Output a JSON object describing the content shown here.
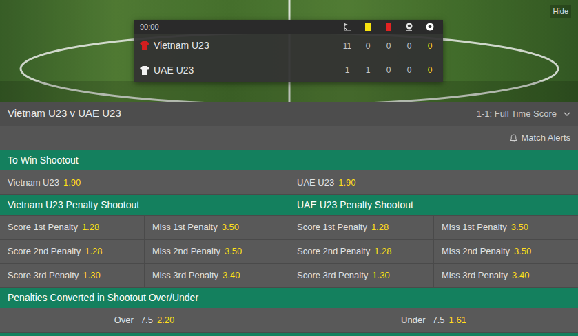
{
  "scoreboard": {
    "time": "90:00",
    "hide": "Hide",
    "teams": [
      {
        "name": "Vietnam U23",
        "color": "#d21f1f",
        "stats": [
          "11",
          "0",
          "0",
          "0",
          "0"
        ]
      },
      {
        "name": "UAE U23",
        "color": "#f2f2f2",
        "stats": [
          "1",
          "1",
          "0",
          "0",
          "0"
        ]
      }
    ]
  },
  "match": {
    "title": "Vietnam U23 v UAE U23",
    "score_label": "1-1: Full Time Score",
    "alerts": "Match Alerts"
  },
  "markets": [
    {
      "kind": "two-way",
      "title": "To Win Shootout",
      "selections": [
        {
          "label": "Vietnam U23",
          "odds": "1.90"
        },
        {
          "label": "UAE U23",
          "odds": "1.90"
        }
      ]
    },
    {
      "kind": "columns",
      "columns": [
        {
          "title": "Vietnam U23 Penalty Shootout",
          "rows": [
            [
              {
                "label": "Score 1st Penalty",
                "odds": "1.28"
              },
              {
                "label": "Miss 1st Penalty",
                "odds": "3.50"
              }
            ],
            [
              {
                "label": "Score 2nd Penalty",
                "odds": "1.28"
              },
              {
                "label": "Miss 2nd Penalty",
                "odds": "3.50"
              }
            ],
            [
              {
                "label": "Score 3rd Penalty",
                "odds": "1.30"
              },
              {
                "label": "Miss 3rd Penalty",
                "odds": "3.40"
              }
            ]
          ]
        },
        {
          "title": "UAE U23 Penalty Shootout",
          "rows": [
            [
              {
                "label": "Score 1st Penalty",
                "odds": "1.28"
              },
              {
                "label": "Miss 1st Penalty",
                "odds": "3.50"
              }
            ],
            [
              {
                "label": "Score 2nd Penalty",
                "odds": "1.28"
              },
              {
                "label": "Miss 2nd Penalty",
                "odds": "3.50"
              }
            ],
            [
              {
                "label": "Score 3rd Penalty",
                "odds": "1.30"
              },
              {
                "label": "Miss 3rd Penalty",
                "odds": "3.40"
              }
            ]
          ]
        }
      ]
    },
    {
      "kind": "over-under",
      "title": "Penalties Converted in Shootout Over/Under",
      "selections": [
        {
          "label": "Over",
          "line": "7.5",
          "odds": "2.20"
        },
        {
          "label": "Under",
          "line": "7.5",
          "odds": "1.61"
        }
      ]
    }
  ]
}
